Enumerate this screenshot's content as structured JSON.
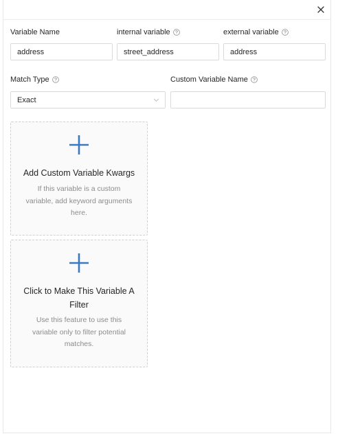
{
  "icons": {
    "close": "close-icon",
    "help": "question-circle-icon",
    "chevron": "chevron-down-icon",
    "plus": "plus-icon"
  },
  "colors": {
    "accent": "#3a78c2",
    "border": "#d9d9d9",
    "card_background": "#fafafa",
    "muted_text": "#8c8c8c"
  },
  "form": {
    "variable_name": {
      "label": "Variable Name",
      "value": "address"
    },
    "internal_variable": {
      "label": "internal variable",
      "value": "street_address"
    },
    "external_variable": {
      "label": "external variable",
      "value": "address"
    },
    "match_type": {
      "label": "Match Type",
      "selected": "Exact"
    },
    "custom_variable_name": {
      "label": "Custom Variable Name",
      "value": ""
    }
  },
  "cards": {
    "kwargs": {
      "title": "Add Custom Variable Kwargs",
      "description": "If this variable is a custom variable, add keyword arguments here."
    },
    "filter": {
      "title": "Click to Make This Variable A Filter",
      "description": "Use this feature to use this variable only to filter potential matches."
    }
  }
}
